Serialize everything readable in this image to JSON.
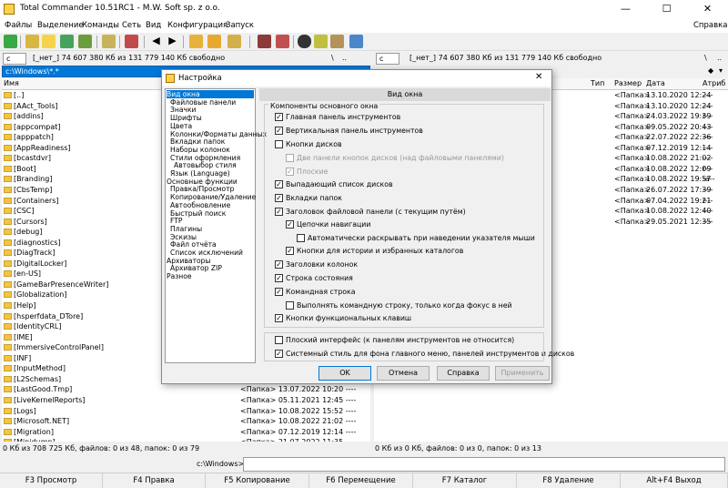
{
  "window": {
    "title": "Total Commander 10.51RC1 - M.W. Soft sp. z o.o.",
    "minimize": "—",
    "maximize": "☐",
    "close": "✕"
  },
  "menu": {
    "items": [
      "Файлы",
      "Выделение",
      "Команды",
      "Сеть",
      "Вид",
      "Конфигурация",
      "Запуск"
    ],
    "help": "Справка"
  },
  "left_panel": {
    "drive": "c",
    "drive_info": "[_нет_]  74 607 380 Кб из 131 779 140 Кб свободно",
    "path": "c:\\Windows\\*.*",
    "col_name": "Имя",
    "rows": [
      {
        "name": "[..]",
        "info": ""
      },
      {
        "name": "[AAct_Tools]",
        "info": ""
      },
      {
        "name": "[addins]",
        "info": ""
      },
      {
        "name": "[appcompat]",
        "info": ""
      },
      {
        "name": "[apppatch]",
        "info": ""
      },
      {
        "name": "[AppReadiness]",
        "info": ""
      },
      {
        "name": "[bcastdvr]",
        "info": ""
      },
      {
        "name": "[Boot]",
        "info": ""
      },
      {
        "name": "[Branding]",
        "info": ""
      },
      {
        "name": "[CbsTemp]",
        "info": ""
      },
      {
        "name": "[Containers]",
        "info": ""
      },
      {
        "name": "[CSC]",
        "info": ""
      },
      {
        "name": "[Cursors]",
        "info": ""
      },
      {
        "name": "[debug]",
        "info": ""
      },
      {
        "name": "[diagnostics]",
        "info": ""
      },
      {
        "name": "[DiagTrack]",
        "info": ""
      },
      {
        "name": "[DigitalLocker]",
        "info": ""
      },
      {
        "name": "[en-US]",
        "info": ""
      },
      {
        "name": "[GameBarPresenceWriter]",
        "info": ""
      },
      {
        "name": "[Globalization]",
        "info": ""
      },
      {
        "name": "[Help]",
        "info": ""
      },
      {
        "name": "[hsperfdata_DTore]",
        "info": ""
      },
      {
        "name": "[IdentityCRL]",
        "info": ""
      },
      {
        "name": "[IME]",
        "info": ""
      },
      {
        "name": "[ImmersiveControlPanel]",
        "info": ""
      },
      {
        "name": "[INF]",
        "info": ""
      },
      {
        "name": "[InputMethod]",
        "info": ""
      },
      {
        "name": "[L2Schemas]",
        "info": ""
      },
      {
        "name": "[LastGood.Tmp]",
        "info": "<Папка> 13.07.2022 10:20  ----"
      },
      {
        "name": "[LiveKernelReports]",
        "info": "<Папка> 05.11.2021 12:45  ----"
      },
      {
        "name": "[Logs]",
        "info": "<Папка> 10.08.2022 15:52  ----"
      },
      {
        "name": "[Microsoft.NET]",
        "info": "<Папка> 10.08.2022 21:02  ----"
      },
      {
        "name": "[Migration]",
        "info": "<Папка> 07.12.2019 12:14  ----"
      },
      {
        "name": "[Minidump]",
        "info": "<Папка> 21.07.2022 11:35  ----"
      }
    ],
    "status": "0 Кб из 708 725 Кб, файлов: 0 из 48, папок: 0 из 79"
  },
  "right_panel": {
    "drive": "c",
    "drive_info": "[_нет_]  74 607 380 Кб из 131 779 140 Кб свободно",
    "nav_back": "\\",
    "nav_up": "..",
    "cols": {
      "type": "Тип",
      "size": "Размер",
      "date": "Дата",
      "attr": "Атриб"
    },
    "rows": [
      {
        "size": "<Папка>",
        "date": "13.10.2020 12:24",
        "attr": "----"
      },
      {
        "size": "<Папка>",
        "date": "13.10.2020 12:24",
        "attr": "----"
      },
      {
        "size": "<Папка>",
        "date": "24.03.2022 19:39",
        "attr": "r---"
      },
      {
        "size": "<Папка>",
        "date": "09.05.2022 20:43",
        "attr": "----"
      },
      {
        "size": "<Папка>",
        "date": "22.07.2022 22:36",
        "attr": "----"
      },
      {
        "size": "<Папка>",
        "date": "07.12.2019 12:14",
        "attr": "----"
      },
      {
        "size": "<Папка>",
        "date": "10.08.2022 21:02",
        "attr": "----"
      },
      {
        "size": "<Папка>",
        "date": "10.08.2022 12:09",
        "attr": "r---"
      },
      {
        "size": "<Папка>",
        "date": "10.08.2022 19:57",
        "attr": "-a--"
      },
      {
        "size": "<Папка>",
        "date": "26.07.2022 17:39",
        "attr": "----"
      },
      {
        "size": "<Папка>",
        "date": "07.04.2022 19:21",
        "attr": "r---"
      },
      {
        "size": "<Папка>",
        "date": "10.08.2022 12:40",
        "attr": "----"
      },
      {
        "size": "<Папка>",
        "date": "29.05.2021 12:35",
        "attr": "----"
      }
    ],
    "status": "0 Кб из 0 Кб, файлов: 0 из 0, папок: 0 из 13"
  },
  "cmdline": {
    "label": "c:\\Windows>"
  },
  "fkeys": [
    "F3 Просмотр",
    "F4 Правка",
    "F5 Копирование",
    "F6 Перемещение",
    "F7 Каталог",
    "F8 Удаление",
    "Alt+F4 Выход"
  ],
  "dialog": {
    "title": "Настройка",
    "close": "✕",
    "tree": [
      "Вид окна",
      "Файловые панели",
      "Значки",
      "Шрифты",
      "Цвета",
      "Колонки/Форматы данных",
      "Вкладки папок",
      "Наборы колонок",
      "Стили оформления",
      "Автовыбор стиля",
      "Язык (Language)",
      "Основные функции",
      "Правка/Просмотр",
      "Копирование/Удаление",
      "Автообновление",
      "Быстрый поиск",
      "FTP",
      "Плагины",
      "Эскизы",
      "Файл отчёта",
      "Список исключений",
      "Архиваторы",
      "Архиватор ZIP",
      "Разное"
    ],
    "header": "Вид окна",
    "group_title": "Компоненты основного окна",
    "options": [
      {
        "label": "Главная панель инструментов",
        "checked": true
      },
      {
        "label": "Вертикальная панель инструментов",
        "checked": true
      },
      {
        "label": "Кнопки дисков",
        "checked": false
      },
      {
        "label": "Две панели кнопок дисков (над файловыми панелями)",
        "checked": false
      },
      {
        "label": "Плоские",
        "checked": true
      },
      {
        "label": "Выпадающий список дисков",
        "checked": true
      },
      {
        "label": "Вкладки папок",
        "checked": true
      },
      {
        "label": "Заголовок файловой панели (с текущим путём)",
        "checked": true
      },
      {
        "label": "Цепочки навигации",
        "checked": true
      },
      {
        "label": "Автоматически раскрывать при наведении указателя мыши",
        "checked": false
      },
      {
        "label": "Кнопки для истории и избранных каталогов",
        "checked": true
      },
      {
        "label": "Заголовки колонок",
        "checked": true
      },
      {
        "label": "Строка состояния",
        "checked": true
      },
      {
        "label": "Командная строка",
        "checked": true
      },
      {
        "label": "Выполнять командную строку, только когда фокус в ней",
        "checked": false
      },
      {
        "label": "Кнопки функциональных клавиш",
        "checked": true
      },
      {
        "label": "Плоский интерфейс (к панелям инструментов не относится)",
        "checked": false
      },
      {
        "label": "Системный стиль для фона главного меню, панелей инструментов и дисков",
        "checked": true
      }
    ],
    "buttons": {
      "ok": "OK",
      "cancel": "Отмена",
      "help": "Справка",
      "apply": "Применить"
    }
  },
  "colors": {
    "accent": "#0078d7",
    "selection": "#0078d7",
    "panel_bg": "#ffffff",
    "chrome": "#f0f0f0"
  }
}
